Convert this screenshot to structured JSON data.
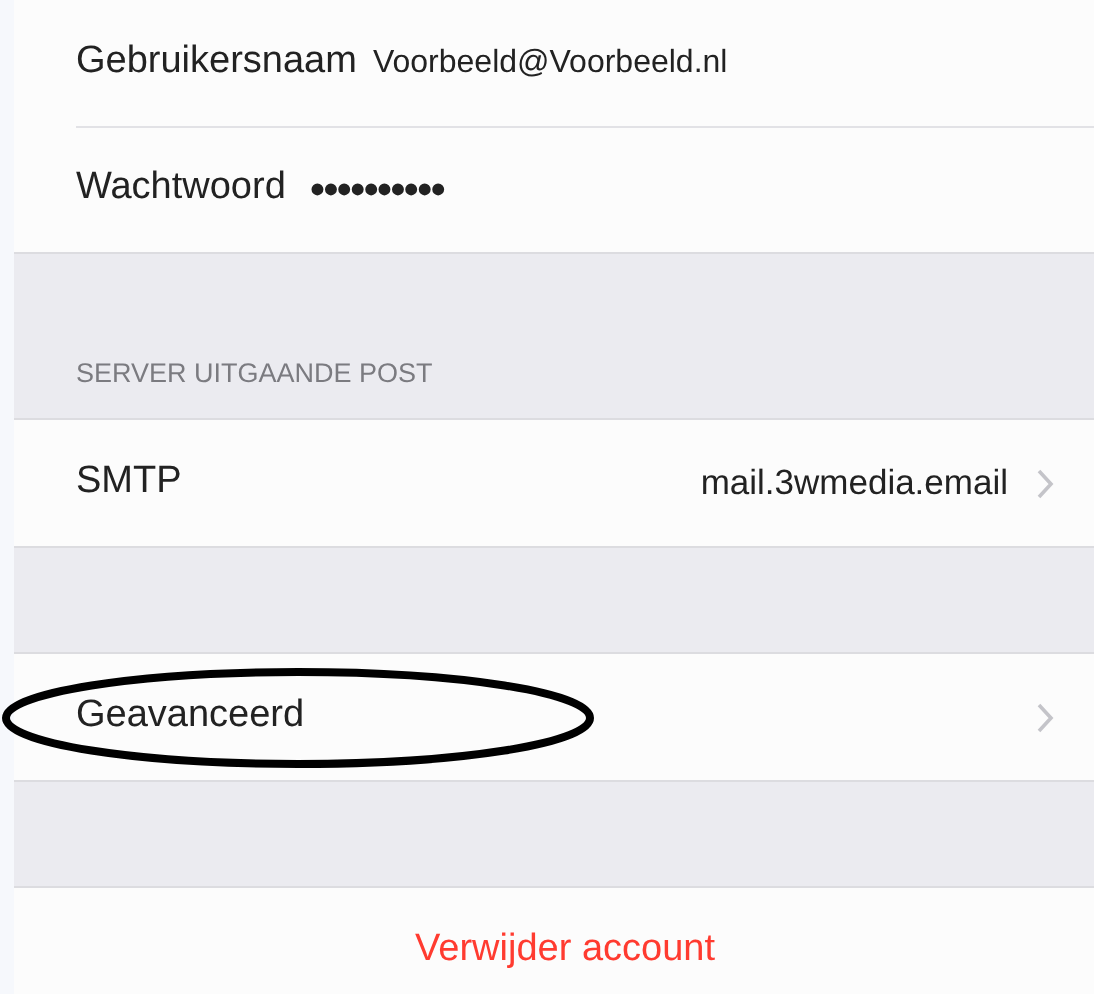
{
  "sections": [
    {
      "rows": [
        {
          "kind": "field",
          "label": "Gebruikersnaam",
          "value": "Voorbeeld@Voorbeeld.nl"
        },
        {
          "kind": "password",
          "label": "Wachtwoord",
          "value": "••••••••••"
        }
      ]
    },
    {
      "header": "SERVER UITGAANDE POST",
      "rows": [
        {
          "kind": "link",
          "label": "SMTP",
          "value": "mail.3wmedia.email",
          "circled": false
        }
      ]
    },
    {
      "rows": [
        {
          "kind": "link",
          "label": "Geavanceerd",
          "circled": true
        }
      ]
    },
    {
      "rows": [
        {
          "kind": "destructive",
          "label": "Verwijder account"
        }
      ]
    }
  ]
}
